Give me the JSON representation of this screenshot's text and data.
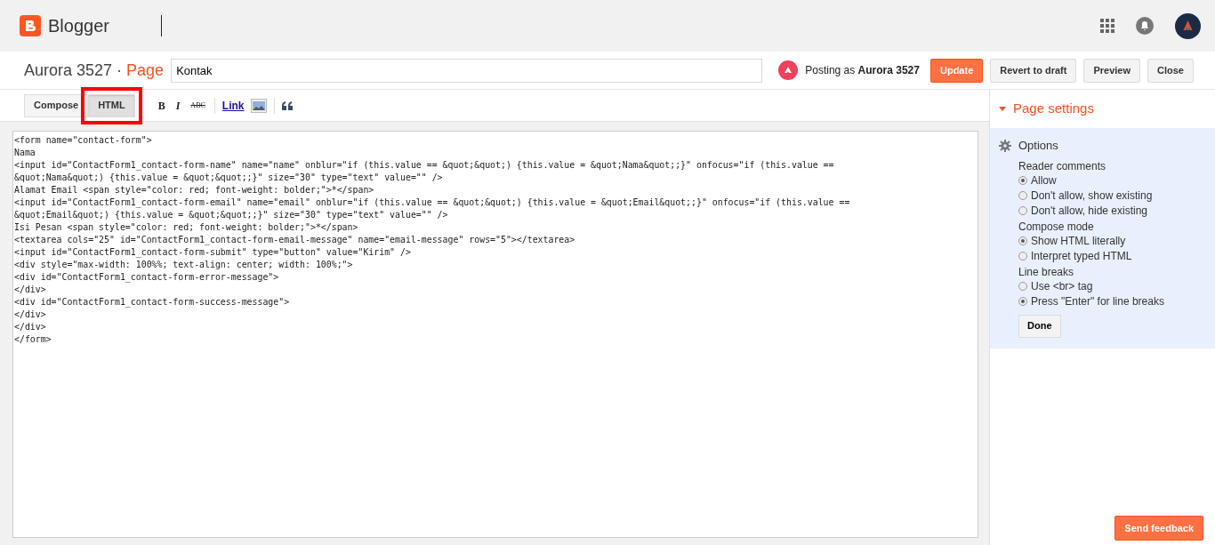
{
  "app": {
    "name": "Blogger"
  },
  "header": {
    "blog_name": "Aurora 3527",
    "separator": "·",
    "page_label": "Page",
    "title_value": "Kontak",
    "posting_prefix": "Posting as",
    "posting_name": "Aurora 3527",
    "buttons": [
      {
        "label": "Update",
        "kind": "primary"
      },
      {
        "label": "Revert to draft",
        "kind": "default"
      },
      {
        "label": "Preview",
        "kind": "default"
      },
      {
        "label": "Close",
        "kind": "default"
      }
    ]
  },
  "toolbar": {
    "modes": [
      {
        "label": "Compose",
        "selected": false,
        "highlighted": false
      },
      {
        "label": "HTML",
        "selected": true,
        "highlighted": true
      }
    ],
    "tools": [
      {
        "kind": "bold",
        "label": "B"
      },
      {
        "kind": "italic",
        "label": "I"
      },
      {
        "kind": "strike",
        "label": "ABC"
      },
      {
        "kind": "divider"
      },
      {
        "kind": "link",
        "label": "Link"
      },
      {
        "kind": "image"
      },
      {
        "kind": "divider"
      },
      {
        "kind": "quote"
      }
    ]
  },
  "editor": {
    "lines": [
      "<form name=\"contact-form\">",
      "Nama",
      "<input id=\"ContactForm1_contact-form-name\" name=\"name\" onblur=\"if (this.value == &quot;&quot;) {this.value = &quot;Nama&quot;;}\" onfocus=\"if (this.value ==",
      "&quot;Nama&quot;) {this.value = &quot;&quot;;}\" size=\"30\" type=\"text\" value=\"\" />",
      "Alamat Email <span style=\"color: red; font-weight: bolder;\">*</span>",
      "<input id=\"ContactForm1_contact-form-email\" name=\"email\" onblur=\"if (this.value == &quot;&quot;) {this.value = &quot;Email&quot;;}\" onfocus=\"if (this.value ==",
      "&quot;Email&quot;) {this.value = &quot;&quot;;}\" size=\"30\" type=\"text\" value=\"\" />",
      "Isi Pesan <span style=\"color: red; font-weight: bolder;\">*</span>",
      "<textarea cols=\"25\" id=\"ContactForm1_contact-form-email-message\" name=\"email-message\" rows=\"5\"></textarea>",
      "<input id=\"ContactForm1_contact-form-submit\" type=\"button\" value=\"Kirim\" />",
      "<div style=\"max-width: 100%%; text-align: center; width: 100%;\">",
      "<div id=\"ContactForm1_contact-form-error-message\">",
      "</div>",
      "<div id=\"ContactForm1_contact-form-success-message\">",
      "</div>",
      "</div>",
      "</form>"
    ]
  },
  "settings": {
    "title": "Page settings",
    "expanded": true,
    "section": "Options",
    "groups": [
      {
        "label": "Reader comments",
        "options": [
          {
            "label": "Allow",
            "selected": true
          },
          {
            "label": "Don't allow, show existing",
            "selected": false
          },
          {
            "label": "Don't allow, hide existing",
            "selected": false
          }
        ]
      },
      {
        "label": "Compose mode",
        "options": [
          {
            "label": "Show HTML literally",
            "selected": true
          },
          {
            "label": "Interpret typed HTML",
            "selected": false
          }
        ]
      },
      {
        "label": "Line breaks",
        "options": [
          {
            "label": "Use <br> tag",
            "selected": false
          },
          {
            "label": "Press \"Enter\" for line breaks",
            "selected": true
          }
        ]
      }
    ],
    "done": "Done"
  },
  "feedback": {
    "label": "Send feedback"
  }
}
